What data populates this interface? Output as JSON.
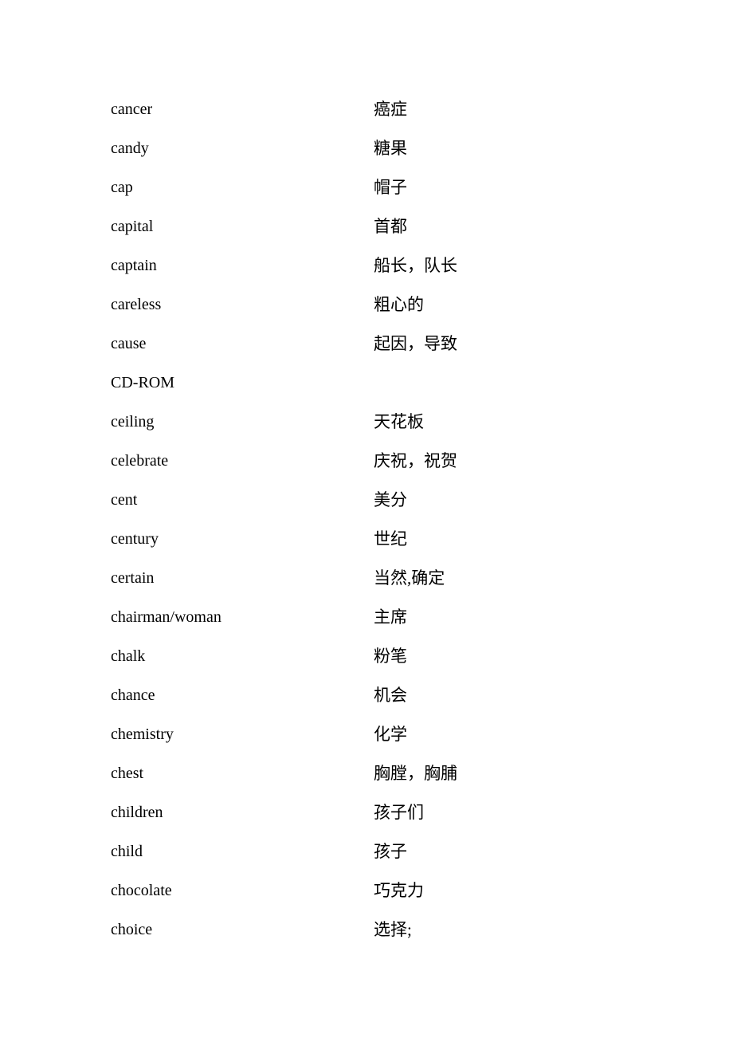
{
  "vocabulary": [
    {
      "word": "cancer",
      "meaning": "癌症"
    },
    {
      "word": "candy",
      "meaning": "糖果"
    },
    {
      "word": "cap",
      "meaning": "帽子"
    },
    {
      "word": "capital",
      "meaning": "首都"
    },
    {
      "word": "captain",
      "meaning": "船长，队长"
    },
    {
      "word": "careless",
      "meaning": "粗心的"
    },
    {
      "word": "cause",
      "meaning": "起因，导致"
    },
    {
      "word": "CD-ROM",
      "meaning": ""
    },
    {
      "word": "ceiling",
      "meaning": "天花板"
    },
    {
      "word": "celebrate",
      "meaning": "庆祝，祝贺"
    },
    {
      "word": "cent",
      "meaning": "美分"
    },
    {
      "word": "century",
      "meaning": "世纪"
    },
    {
      "word": "certain",
      "meaning": "当然,确定"
    },
    {
      "word": "chairman/woman",
      "meaning": "主席"
    },
    {
      "word": "chalk",
      "meaning": "粉笔"
    },
    {
      "word": "chance",
      "meaning": "机会"
    },
    {
      "word": "chemistry",
      "meaning": "化学"
    },
    {
      "word": "chest",
      "meaning": "胸膛，胸脯"
    },
    {
      "word": "children",
      "meaning": "孩子们"
    },
    {
      "word": "child",
      "meaning": "孩子"
    },
    {
      "word": "chocolate",
      "meaning": "巧克力"
    },
    {
      "word": "choice",
      "meaning": "选择;"
    }
  ]
}
